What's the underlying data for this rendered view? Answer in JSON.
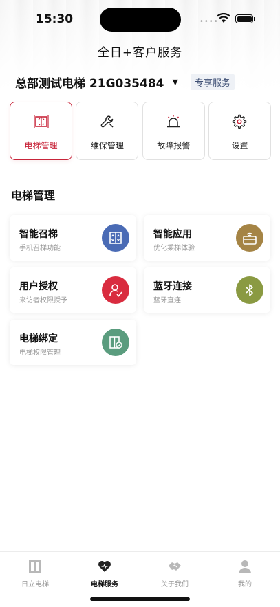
{
  "status_bar": {
    "time": "15:30",
    "dots": "••••"
  },
  "header": {
    "title": "全日+客户服务",
    "device_name": "总部测试电梯 21G035484",
    "vip_badge": "专享服务"
  },
  "top_tabs": [
    {
      "label": "电梯管理",
      "icon": "elevator-icon",
      "active": true
    },
    {
      "label": "维保管理",
      "icon": "wrench-icon",
      "active": false
    },
    {
      "label": "故障报警",
      "icon": "alarm-icon",
      "active": false
    },
    {
      "label": "设置",
      "icon": "gear-icon",
      "active": false
    }
  ],
  "section": {
    "title": "电梯管理"
  },
  "cards": [
    {
      "title": "智能召梯",
      "subtitle": "手机召梯功能",
      "icon": "elevator-call-icon",
      "color": "#4a6bb5"
    },
    {
      "title": "智能应用",
      "subtitle": "优化乘梯体验",
      "icon": "card-reader-icon",
      "color": "#a58445"
    },
    {
      "title": "用户授权",
      "subtitle": "来访者权限授予",
      "icon": "user-auth-icon",
      "color": "#d92c3f"
    },
    {
      "title": "蓝牙连接",
      "subtitle": "蓝牙直连",
      "icon": "bluetooth-icon",
      "color": "#8a9a42"
    },
    {
      "title": "电梯绑定",
      "subtitle": "电梯权限管理",
      "icon": "elevator-bind-icon",
      "color": "#5a9c7e"
    }
  ],
  "bottom_nav": [
    {
      "label": "日立电梯",
      "icon": "elevator-icon",
      "active": false
    },
    {
      "label": "电梯服务",
      "icon": "heart-icon",
      "active": true
    },
    {
      "label": "关于我们",
      "icon": "handshake-icon",
      "active": false
    },
    {
      "label": "我的",
      "icon": "person-icon",
      "active": false
    }
  ],
  "colors": {
    "accent": "#c8253a",
    "badge_bg": "#eef1f6",
    "badge_text": "#3e4f74"
  }
}
